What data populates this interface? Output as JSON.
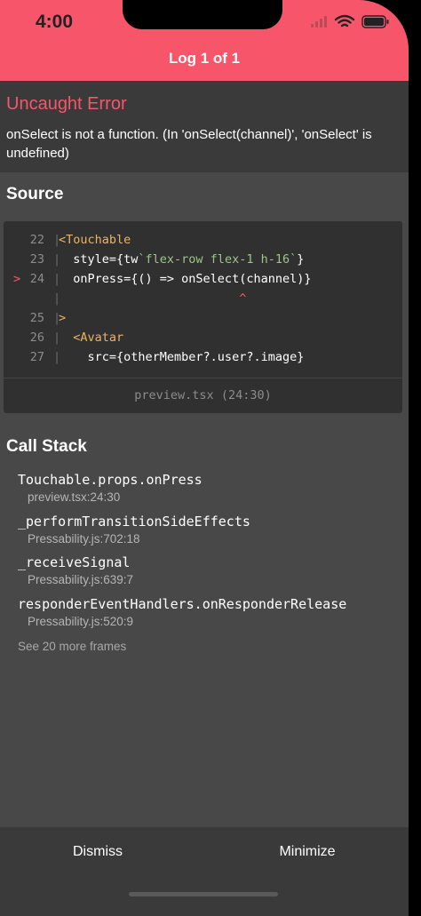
{
  "status_bar": {
    "time": "4:00"
  },
  "header": {
    "title": "Log 1 of 1"
  },
  "error": {
    "title": "Uncaught Error",
    "message": "onSelect is not a function. (In 'onSelect(channel)', 'onSelect' is undefined)"
  },
  "source": {
    "title": "Source",
    "lines": [
      {
        "num": "22",
        "marker": "",
        "parts": [
          {
            "t": "<Touchable",
            "c": "tag"
          }
        ]
      },
      {
        "num": "23",
        "marker": "",
        "parts": [
          {
            "t": "  style={tw",
            "c": ""
          },
          {
            "t": "`flex-row flex-1 h-16`",
            "c": "str"
          },
          {
            "t": "}",
            "c": ""
          }
        ]
      },
      {
        "num": "24",
        "marker": ">",
        "parts": [
          {
            "t": "  onPress={() => onSelect(channel)}",
            "c": ""
          }
        ]
      },
      {
        "num": "",
        "marker": "",
        "parts": [
          {
            "t": "                         ^",
            "c": "caret-line"
          }
        ]
      },
      {
        "num": "25",
        "marker": "",
        "parts": [
          {
            "t": ">",
            "c": "tag"
          }
        ]
      },
      {
        "num": "26",
        "marker": "",
        "parts": [
          {
            "t": "  <Avatar",
            "c": "tag"
          }
        ]
      },
      {
        "num": "27",
        "marker": "",
        "parts": [
          {
            "t": "    src={otherMember?.user?.image}",
            "c": ""
          }
        ]
      }
    ],
    "file_ref": "preview.tsx (24:30)"
  },
  "call_stack": {
    "title": "Call Stack",
    "frames": [
      {
        "name": "Touchable.props.onPress",
        "location": "preview.tsx:24:30"
      },
      {
        "name": "_performTransitionSideEffects",
        "location": "Pressability.js:702:18"
      },
      {
        "name": "_receiveSignal",
        "location": "Pressability.js:639:7"
      },
      {
        "name": "responderEventHandlers.onResponderRelease",
        "location": "Pressability.js:520:9"
      }
    ],
    "see_more": "See 20 more frames"
  },
  "footer": {
    "dismiss_label": "Dismiss",
    "minimize_label": "Minimize"
  },
  "colors": {
    "accent": "#f7566a",
    "background": "#484848",
    "panel": "#3a3a3a",
    "code_bg": "#303030"
  }
}
